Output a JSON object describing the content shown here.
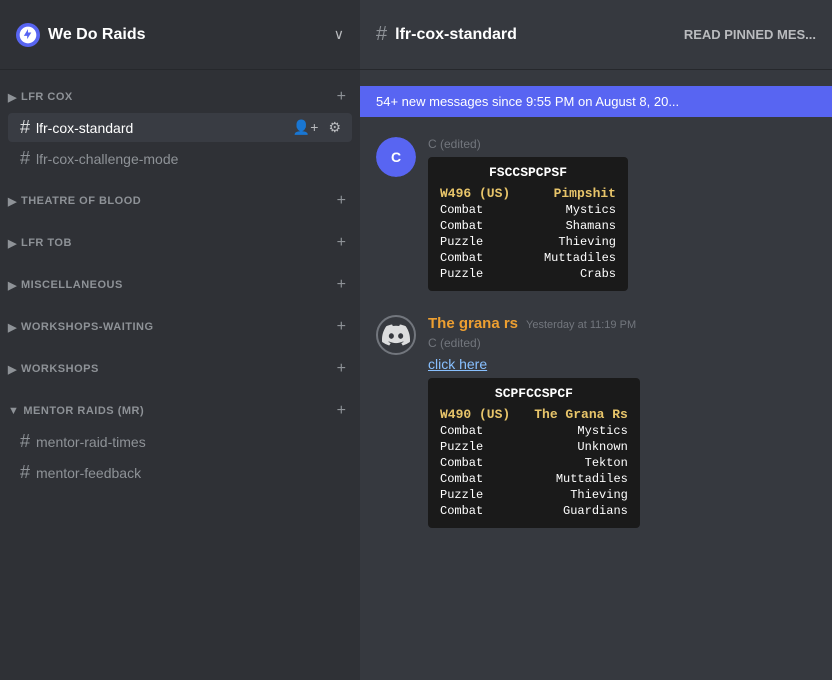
{
  "server": {
    "name": "We Do Raids",
    "icon": "⚔"
  },
  "sidebar": {
    "categories": [
      {
        "id": "lfr-cox",
        "label": "LFR COX",
        "collapsed": false,
        "channels": [
          {
            "id": "lfr-cox-standard",
            "name": "lfr-cox-standard",
            "active": true
          },
          {
            "id": "lfr-cox-challenge-mode",
            "name": "lfr-cox-challenge-mode",
            "active": false
          }
        ]
      },
      {
        "id": "theatre-of-blood",
        "label": "THEATRE OF BLOOD",
        "collapsed": false,
        "channels": []
      },
      {
        "id": "lfr-tob",
        "label": "LFR TOB",
        "collapsed": false,
        "channels": []
      },
      {
        "id": "miscellaneous",
        "label": "MISCELLANEOUS",
        "collapsed": false,
        "channels": []
      },
      {
        "id": "workshops-waiting",
        "label": "WORKSHOPS-WAITING",
        "collapsed": false,
        "channels": []
      },
      {
        "id": "workshops",
        "label": "WORKSHOPS",
        "collapsed": false,
        "channels": []
      },
      {
        "id": "mentor-raids",
        "label": "MENTOR RAIDS (MR)",
        "collapsed": false,
        "channels": [
          {
            "id": "mentor-raid-times",
            "name": "mentor-raid-times",
            "active": false
          },
          {
            "id": "mentor-feedback",
            "name": "mentor-feedback",
            "active": false
          }
        ]
      }
    ]
  },
  "channel_header": {
    "hash": "#",
    "name": "lfr-cox-standard",
    "read_pinned": "READ PINNED MES..."
  },
  "banner": {
    "text": "54+ new messages since 9:55 PM on August 8, 20..."
  },
  "messages": [
    {
      "id": "msg1",
      "author": "",
      "avatar_type": "image",
      "timestamp": "",
      "edited": "C (edited)",
      "card": {
        "title": "FSCCSPCPSF",
        "header_left": "W496 (US)",
        "header_right": "Pimpshit",
        "rows": [
          {
            "left": "Combat",
            "right": "Mystics"
          },
          {
            "left": "Combat",
            "right": "Shamans"
          },
          {
            "left": "Puzzle",
            "right": "Thieving"
          },
          {
            "left": "Combat",
            "right": "Muttadiles"
          },
          {
            "left": "Puzzle",
            "right": "Crabs"
          }
        ]
      }
    },
    {
      "id": "msg2",
      "author": "The grana rs",
      "avatar_type": "discord",
      "timestamp": "Yesterday at 11:19 PM",
      "edited": "C (edited)",
      "partial_text": "click here",
      "card": {
        "title": "SCPFCCSPCF",
        "header_left": "W490 (US)",
        "header_right": "The Grana Rs",
        "rows": [
          {
            "left": "Combat",
            "right": "Mystics"
          },
          {
            "left": "Puzzle",
            "right": "Unknown"
          },
          {
            "left": "Combat",
            "right": "Tekton"
          },
          {
            "left": "Combat",
            "right": "Muttadiles"
          },
          {
            "left": "Puzzle",
            "right": "Thieving"
          },
          {
            "left": "Combat",
            "right": "Guardians"
          }
        ]
      }
    }
  ],
  "labels": {
    "add_channel": "+",
    "chevron_down": "∨",
    "category_arrow": "▶"
  }
}
